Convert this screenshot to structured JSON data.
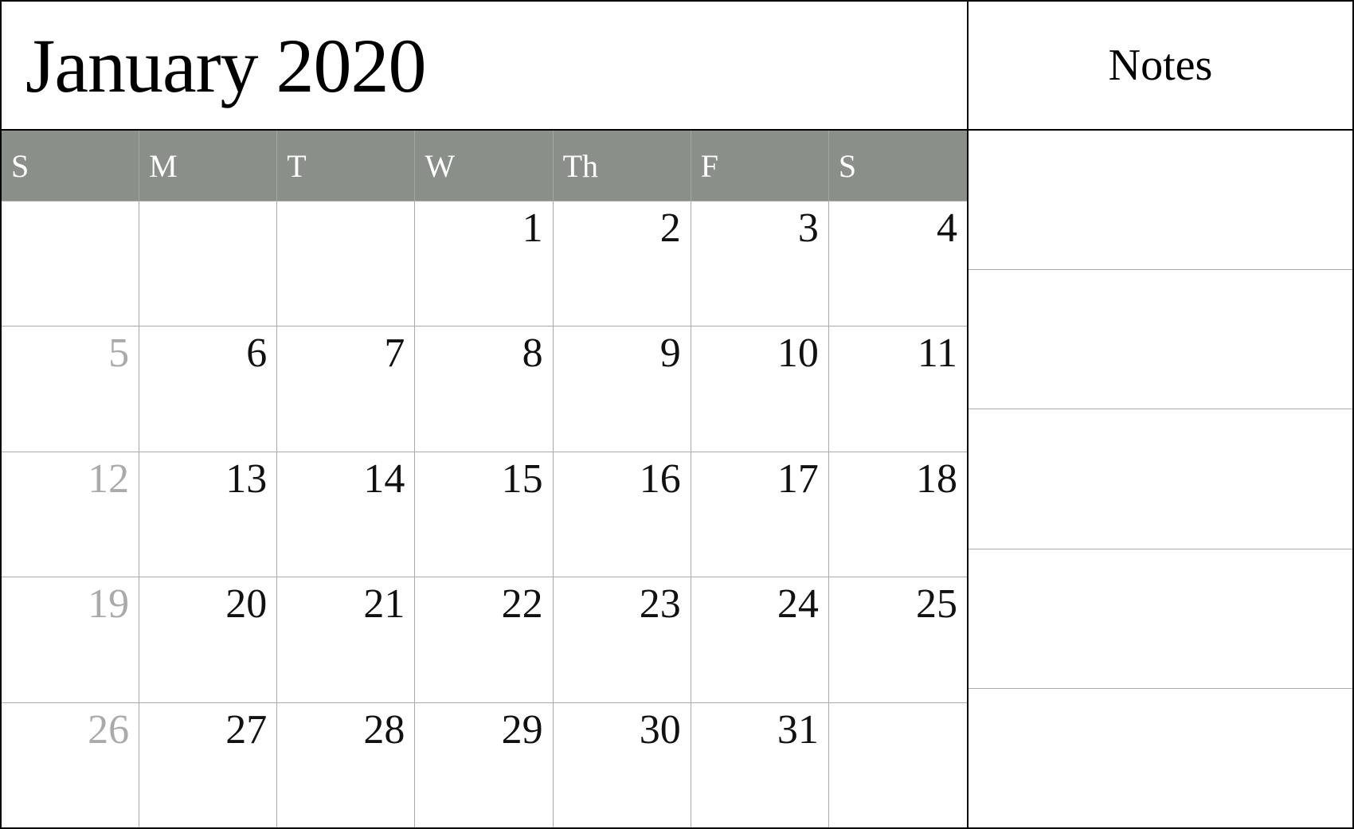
{
  "header": {
    "title": "January 2020",
    "notes_label": "Notes"
  },
  "days": [
    "S",
    "M",
    "T",
    "W",
    "Th",
    "F",
    "S"
  ],
  "weeks": [
    [
      {
        "number": "",
        "dimmed": false,
        "empty": true
      },
      {
        "number": "",
        "dimmed": false,
        "empty": true
      },
      {
        "number": "",
        "dimmed": false,
        "empty": true
      },
      {
        "number": "1",
        "dimmed": false,
        "empty": false
      },
      {
        "number": "2",
        "dimmed": false,
        "empty": false
      },
      {
        "number": "3",
        "dimmed": false,
        "empty": false
      },
      {
        "number": "4",
        "dimmed": false,
        "empty": false
      }
    ],
    [
      {
        "number": "5",
        "dimmed": true,
        "empty": false
      },
      {
        "number": "6",
        "dimmed": false,
        "empty": false
      },
      {
        "number": "7",
        "dimmed": false,
        "empty": false
      },
      {
        "number": "8",
        "dimmed": false,
        "empty": false
      },
      {
        "number": "9",
        "dimmed": false,
        "empty": false
      },
      {
        "number": "10",
        "dimmed": false,
        "empty": false
      },
      {
        "number": "11",
        "dimmed": false,
        "empty": false
      }
    ],
    [
      {
        "number": "12",
        "dimmed": true,
        "empty": false
      },
      {
        "number": "13",
        "dimmed": false,
        "empty": false
      },
      {
        "number": "14",
        "dimmed": false,
        "empty": false
      },
      {
        "number": "15",
        "dimmed": false,
        "empty": false
      },
      {
        "number": "16",
        "dimmed": false,
        "empty": false
      },
      {
        "number": "17",
        "dimmed": false,
        "empty": false
      },
      {
        "number": "18",
        "dimmed": false,
        "empty": false
      }
    ],
    [
      {
        "number": "19",
        "dimmed": true,
        "empty": false
      },
      {
        "number": "20",
        "dimmed": false,
        "empty": false
      },
      {
        "number": "21",
        "dimmed": false,
        "empty": false
      },
      {
        "number": "22",
        "dimmed": false,
        "empty": false
      },
      {
        "number": "23",
        "dimmed": false,
        "empty": false
      },
      {
        "number": "24",
        "dimmed": false,
        "empty": false
      },
      {
        "number": "25",
        "dimmed": false,
        "empty": false
      }
    ],
    [
      {
        "number": "26",
        "dimmed": true,
        "empty": false
      },
      {
        "number": "27",
        "dimmed": false,
        "empty": false
      },
      {
        "number": "28",
        "dimmed": false,
        "empty": false
      },
      {
        "number": "29",
        "dimmed": false,
        "empty": false
      },
      {
        "number": "30",
        "dimmed": false,
        "empty": false
      },
      {
        "number": "31",
        "dimmed": false,
        "empty": false
      },
      {
        "number": "",
        "dimmed": false,
        "empty": true
      }
    ]
  ]
}
